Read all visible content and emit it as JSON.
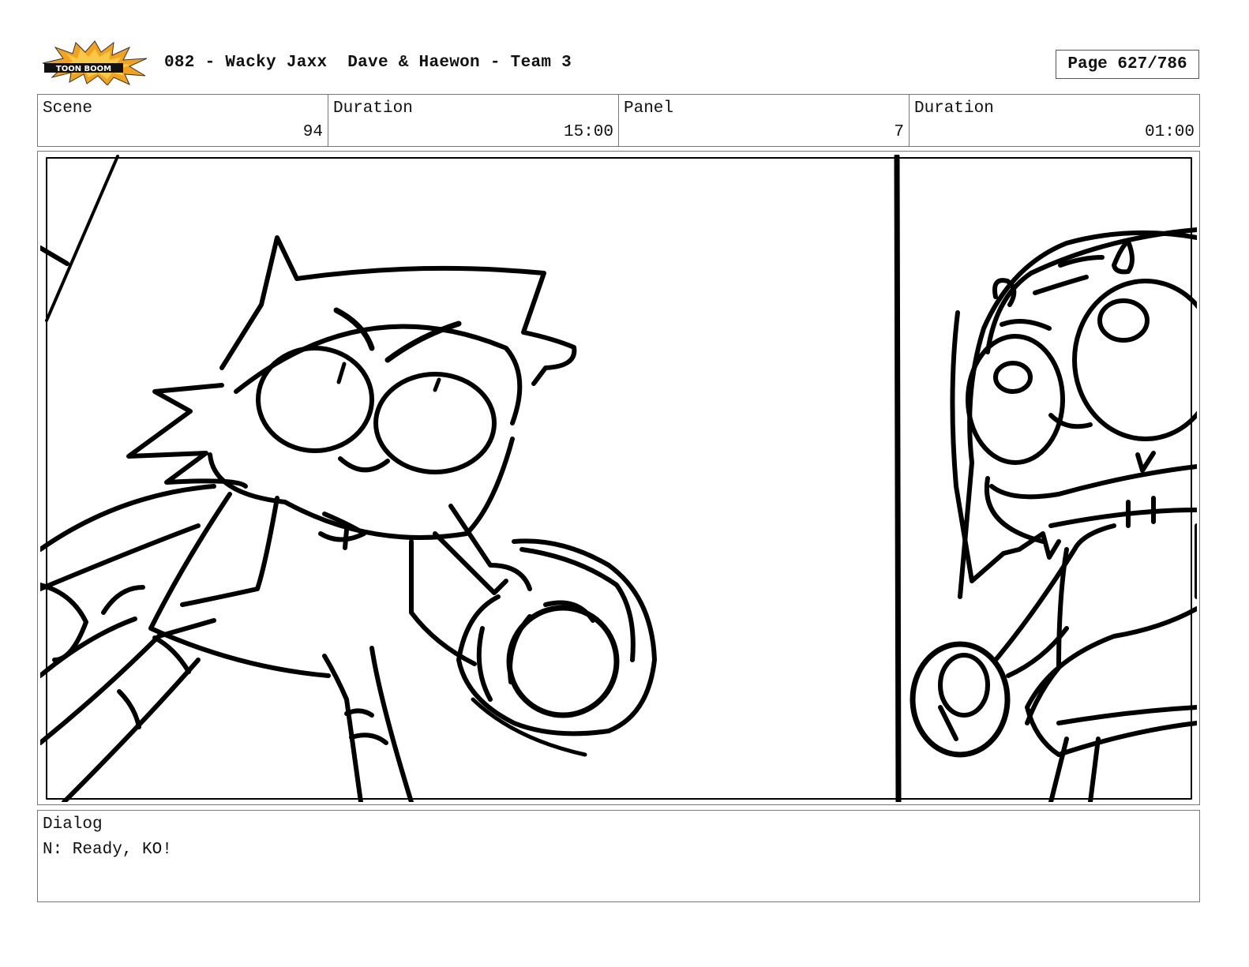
{
  "header": {
    "logo_text": "TOON BOOM",
    "title": "082 - Wacky Jaxx  Dave & Haewon - Team 3",
    "page_label": "Page 627/786"
  },
  "info": {
    "scene_label": "Scene",
    "scene_value": "94",
    "scene_duration_label": "Duration",
    "scene_duration_value": "15:00",
    "panel_label": "Panel",
    "panel_value": "7",
    "panel_duration_label": "Duration",
    "panel_duration_value": "01:00"
  },
  "panel": {
    "sketch": "storyboard drawing"
  },
  "dialog": {
    "label": "Dialog",
    "text": "N: Ready, KO!"
  },
  "colors": {
    "logo_burst": "#f5a21b",
    "logo_burst_inner": "#f7c948",
    "ink": "#000000",
    "border": "#777777"
  }
}
